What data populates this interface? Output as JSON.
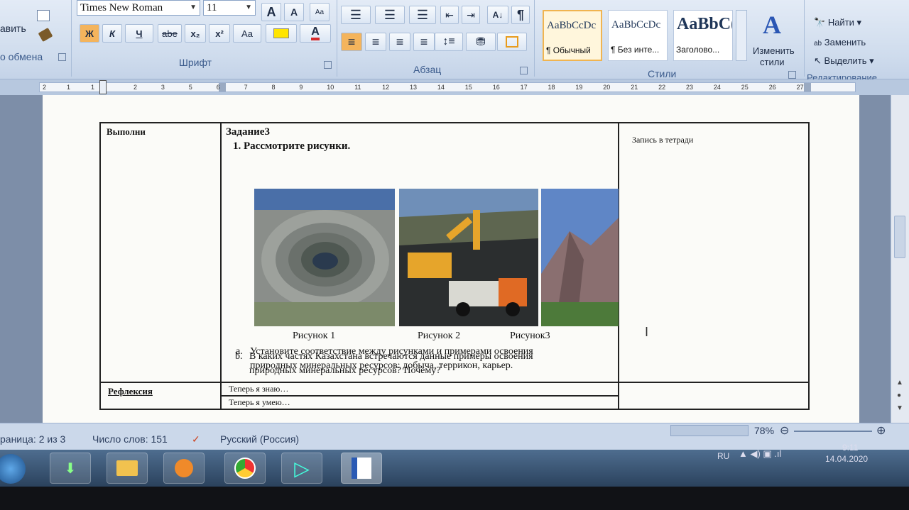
{
  "ribbon": {
    "clipboard": {
      "paste_label": "авить",
      "group_label": "о обмена"
    },
    "font": {
      "font_name": "Times New Roman",
      "font_size": "11",
      "bold": "Ж",
      "italic": "К",
      "underline": "Ч",
      "strike": "abe",
      "subscript": "x₂",
      "superscript": "x²",
      "change_case": "Aa",
      "grow": "A",
      "shrink": "A",
      "group_label": "Шрифт"
    },
    "paragraph": {
      "group_label": "Абзац",
      "pilcrow": "¶"
    },
    "styles": {
      "items": [
        {
          "sample": "AaBbCcDc",
          "name": "¶ Обычный"
        },
        {
          "sample": "AaBbCcDc",
          "name": "¶ Без инте..."
        },
        {
          "sample": "AaBbC(",
          "name": "Заголово..."
        }
      ],
      "change_label_1": "Изменить",
      "change_label_2": "стили",
      "group_label": "Стили"
    },
    "editing": {
      "find": "Найти",
      "replace": "Заменить",
      "select": "Выделить",
      "group_label": "Редактирование"
    }
  },
  "ruler": {
    "ticks": [
      "2",
      "1",
      "1",
      "2",
      "3",
      "5",
      "6",
      "7",
      "8",
      "9",
      "10",
      "11",
      "12",
      "13",
      "14",
      "15",
      "16",
      "17",
      "18",
      "19",
      "20",
      "21",
      "22",
      "23",
      "24",
      "25",
      "26",
      "27"
    ]
  },
  "document": {
    "col1_row1": "Выполни",
    "task_title": "Задание3",
    "task_subtitle": "1. Рассмотрите рисунки.",
    "notes_header": "Запись в тетради",
    "captions": [
      "Рисунок 1",
      "Рисунок 2",
      "Рисунок3"
    ],
    "item_a_marker": "a.",
    "item_a_line1": "Установите соответствие  между рисунками  и  примерами освоения",
    "item_a_line2": "природных минеральных ресурсов: добыча, террикон, карьер.",
    "item_b_marker": "b.",
    "item_b_line1": "В каких частях Казахстана встречаются  данные примеры освоения",
    "item_b_line2": "природных минеральных ресурсов?  Почему?",
    "reflection_label": "Рефлексия",
    "reflection_1": "Теперь я знаю…",
    "reflection_2": "Теперь я умею…"
  },
  "status": {
    "page": "раница: 2 из 3",
    "words": "Число слов: 151",
    "language": "Русский (Россия)",
    "zoom": "78%"
  },
  "taskbar": {
    "lang": "RU",
    "time": "9:11",
    "date": "14.04.2020"
  },
  "colors": {
    "ribbon": "#d6e2f1",
    "page": "#fbfbf8",
    "workspace": "#7d8ea8",
    "taskbar": "#3a5676",
    "font_color_red": "#d62a2a"
  }
}
